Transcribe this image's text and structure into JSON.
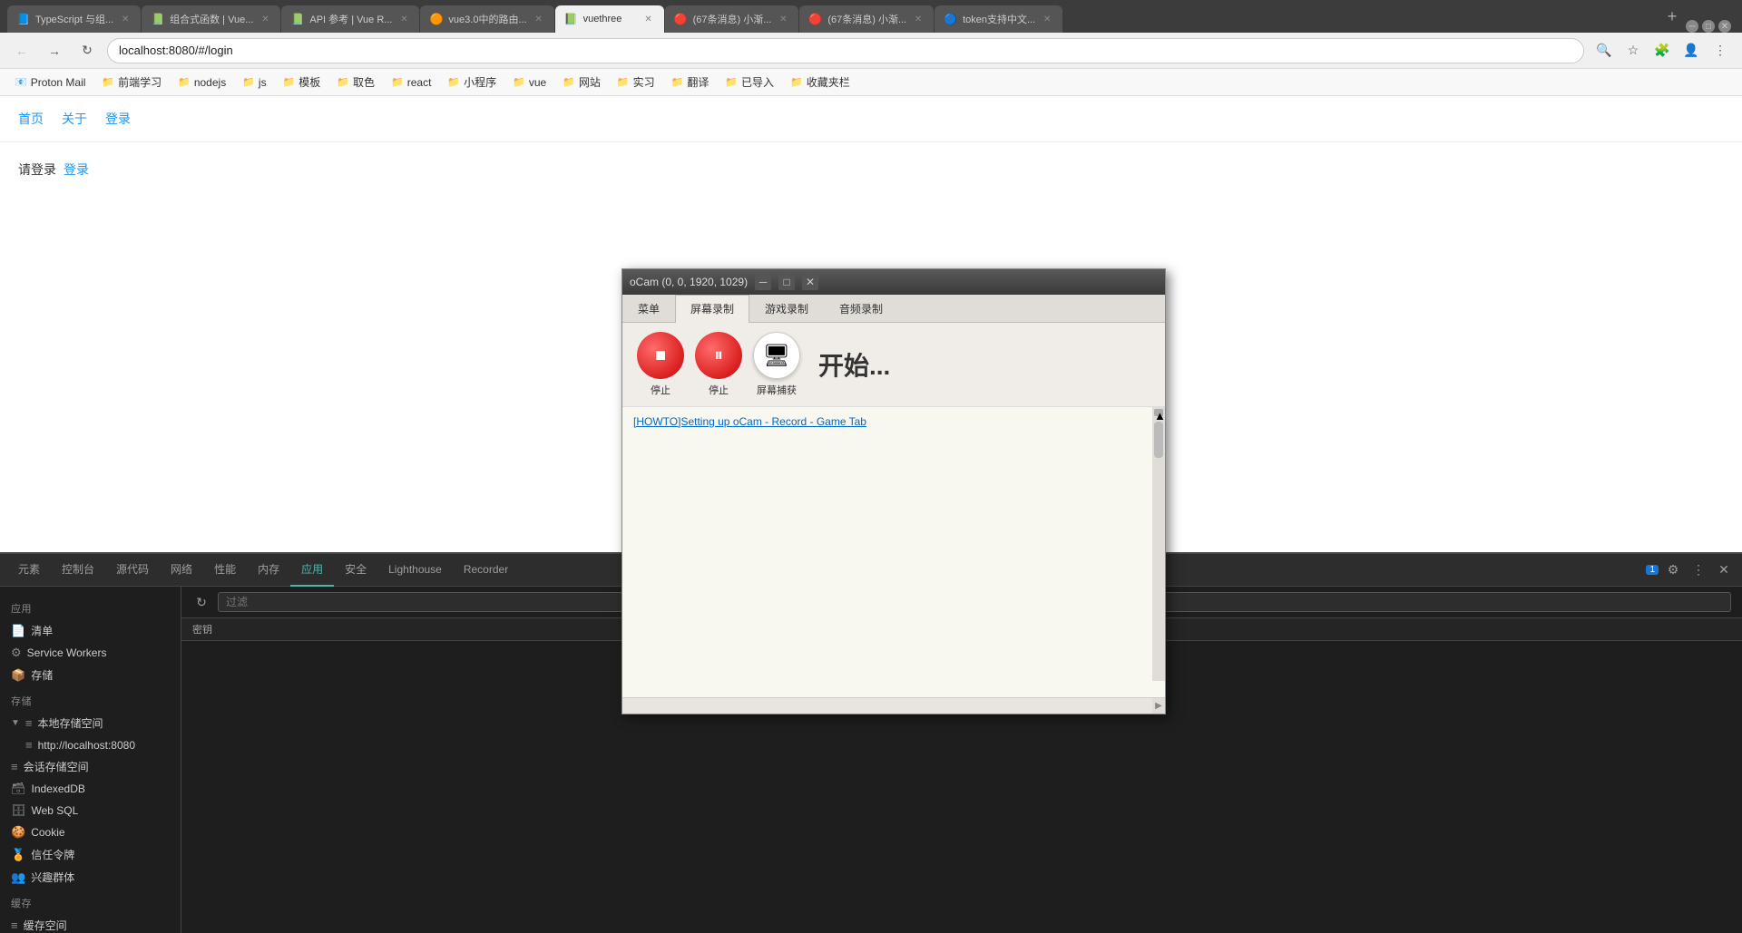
{
  "browser": {
    "title": "oCam (0, 0, 1920, 1029)",
    "address": "localhost:8080/#/login",
    "tabs": [
      {
        "id": "tab1",
        "title": "TypeScript 与组...",
        "favicon": "📘",
        "active": false
      },
      {
        "id": "tab2",
        "title": "组合式函数 | Vue...",
        "favicon": "📗",
        "active": false
      },
      {
        "id": "tab3",
        "title": "API 参考 | Vue R...",
        "favicon": "📗",
        "active": false
      },
      {
        "id": "tab4",
        "title": "vue3.0中的路由...",
        "favicon": "🟠",
        "active": false
      },
      {
        "id": "tab5",
        "title": "vuethree",
        "favicon": "📗",
        "active": true
      },
      {
        "id": "tab6",
        "title": "(67条消息) 小渐...",
        "favicon": "🔴",
        "active": false
      },
      {
        "id": "tab7",
        "title": "(67条消息) 小渐...",
        "favicon": "🔴",
        "active": false
      },
      {
        "id": "tab8",
        "title": "token支持中文...",
        "favicon": "🔵",
        "active": false
      }
    ],
    "bookmarks": [
      {
        "label": "Proton Mail",
        "type": "item"
      },
      {
        "label": "前端学习",
        "type": "folder"
      },
      {
        "label": "nodejs",
        "type": "folder"
      },
      {
        "label": "js",
        "type": "folder"
      },
      {
        "label": "模板",
        "type": "folder"
      },
      {
        "label": "取色",
        "type": "folder"
      },
      {
        "label": "react",
        "type": "folder"
      },
      {
        "label": "小程序",
        "type": "folder"
      },
      {
        "label": "vue",
        "type": "folder"
      },
      {
        "label": "网站",
        "type": "folder"
      },
      {
        "label": "实习",
        "type": "folder"
      },
      {
        "label": "翻译",
        "type": "folder"
      },
      {
        "label": "已导入",
        "type": "folder"
      },
      {
        "label": "收藏夹栏",
        "type": "folder"
      }
    ]
  },
  "page": {
    "nav": {
      "items": [
        "首页",
        "关于",
        "登录"
      ]
    },
    "body": {
      "prompt": "请登录",
      "link": "登录"
    }
  },
  "devtools": {
    "tabs": [
      {
        "id": "elements",
        "label": "元素",
        "active": false
      },
      {
        "id": "console",
        "label": "控制台",
        "active": false
      },
      {
        "id": "sources",
        "label": "源代码",
        "active": false
      },
      {
        "id": "network",
        "label": "网络",
        "active": false
      },
      {
        "id": "performance",
        "label": "性能",
        "active": false
      },
      {
        "id": "memory",
        "label": "内存",
        "active": false
      },
      {
        "id": "application",
        "label": "应用",
        "active": true
      },
      {
        "id": "security",
        "label": "安全",
        "active": false
      },
      {
        "id": "lighthouse",
        "label": "Lighthouse",
        "active": false
      },
      {
        "id": "recorder",
        "label": "Recorder",
        "active": false
      }
    ],
    "badge": "1",
    "sidebar": {
      "sections": [
        {
          "title": "应用",
          "items": [
            {
              "label": "清单",
              "icon": "📄",
              "indent": 0
            },
            {
              "label": "Service Workers",
              "icon": "⚙",
              "indent": 0
            },
            {
              "label": "存储",
              "icon": "📦",
              "indent": 0
            }
          ]
        },
        {
          "title": "存储",
          "items": [
            {
              "label": "本地存储空间",
              "icon": "≡",
              "indent": 0,
              "expanded": true
            },
            {
              "label": "http://localhost:8080",
              "icon": "≡",
              "indent": 1
            },
            {
              "label": "会话存储空间",
              "icon": "≡",
              "indent": 0
            },
            {
              "label": "IndexedDB",
              "icon": "🗃",
              "indent": 0
            },
            {
              "label": "Web SQL",
              "icon": "🗄",
              "indent": 0
            },
            {
              "label": "Cookie",
              "icon": "🍪",
              "indent": 0
            }
          ]
        },
        {
          "title": "",
          "items": [
            {
              "label": "信任令牌",
              "icon": "🏅",
              "indent": 0
            },
            {
              "label": "兴趣群体",
              "icon": "👥",
              "indent": 0
            }
          ]
        },
        {
          "title": "缓存",
          "items": [
            {
              "label": "缓存空间",
              "icon": "≡",
              "indent": 0
            }
          ]
        }
      ]
    },
    "main": {
      "filter_placeholder": "过滤",
      "table_headers": [
        "密钥"
      ],
      "rows": []
    }
  },
  "ocam": {
    "title": "oCam (0, 0, 1920, 1029)",
    "tabs": [
      "菜单",
      "屏幕录制",
      "游戏录制",
      "音频录制"
    ],
    "active_tab": "屏幕录制",
    "buttons": [
      {
        "label": "停止",
        "icon": "⬛",
        "type": "stop"
      },
      {
        "label": "停止",
        "icon": "⏸",
        "type": "pause"
      },
      {
        "label": "屏幕捕获",
        "icon": "🖥",
        "type": "capture"
      }
    ],
    "status_text": "开始...",
    "link": "[HOWTO]Setting up oCam - Record - Game Tab"
  }
}
